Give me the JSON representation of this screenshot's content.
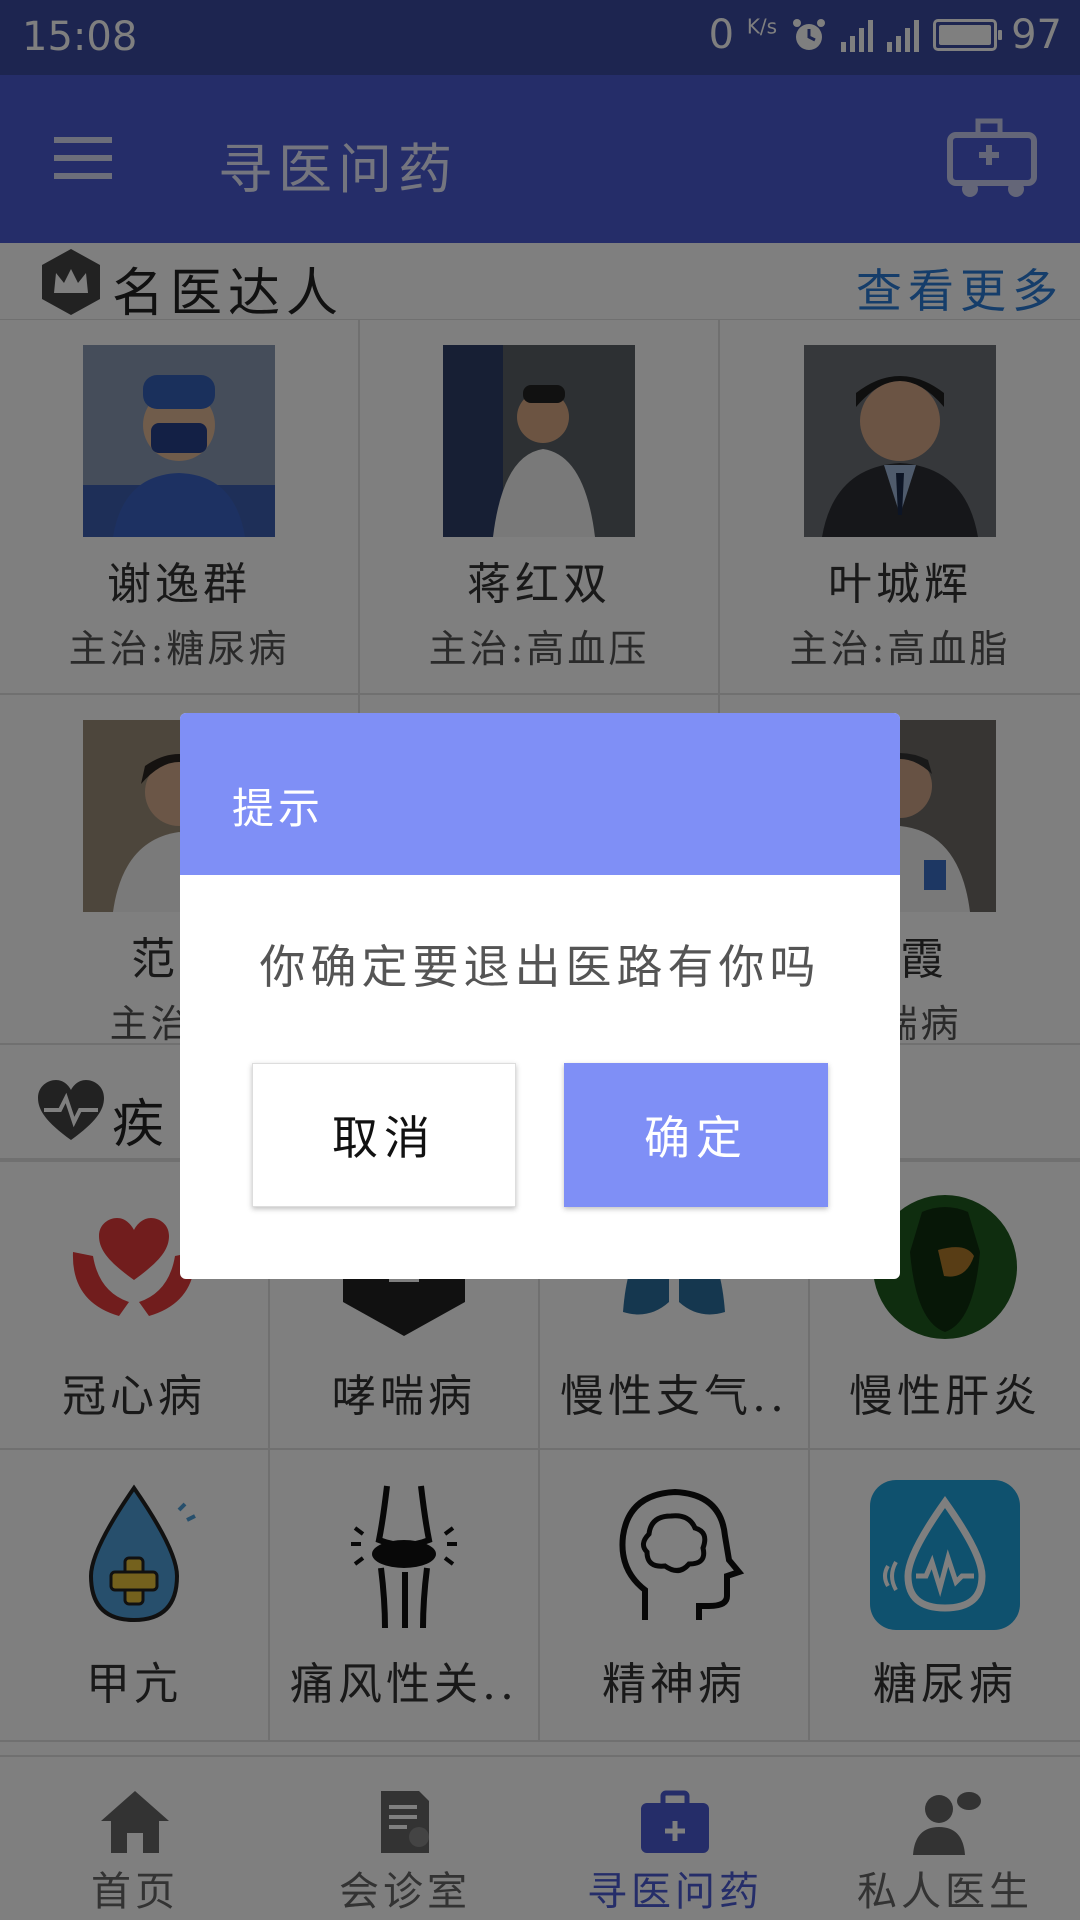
{
  "status_bar": {
    "time": "15:08",
    "net_speed": "0",
    "net_unit": "K/s",
    "network": "4G",
    "battery": "97"
  },
  "app_bar": {
    "title": "寻医问药",
    "menu_icon": "hamburger-menu-icon",
    "action_icon": "ambulance-icon"
  },
  "famous_doctors": {
    "title": "名医达人",
    "more_label": "查看更多",
    "doctors": [
      {
        "name": "谢逸群",
        "specialty": "主治:糖尿病"
      },
      {
        "name": "蒋红双",
        "specialty": "主治:高血压"
      },
      {
        "name": "叶城辉",
        "specialty": "主治:高血脂"
      },
      {
        "name": "范宇",
        "specialty": "主治:宪"
      },
      {
        "name": "",
        "specialty": ""
      },
      {
        "name": "建霞",
        "specialty": "孝喘病"
      }
    ]
  },
  "diseases": {
    "title": "疾",
    "items": [
      {
        "label": "冠心病",
        "icon": "heart-hands-icon"
      },
      {
        "label": "哮喘病",
        "icon": "asthma-icon"
      },
      {
        "label": "慢性支气..",
        "icon": "lungs-icon"
      },
      {
        "label": "慢性肝炎",
        "icon": "liver-icon"
      },
      {
        "label": "甲亢",
        "icon": "water-drop-plus-icon"
      },
      {
        "label": "痛风性关..",
        "icon": "knee-joint-icon"
      },
      {
        "label": "精神病",
        "icon": "brain-head-icon"
      },
      {
        "label": "糖尿病",
        "icon": "diabetes-drop-icon"
      }
    ]
  },
  "bottom_nav": {
    "items": [
      {
        "label": "首页",
        "icon": "home-icon"
      },
      {
        "label": "会诊室",
        "icon": "consultation-icon"
      },
      {
        "label": "寻医问药",
        "icon": "medical-kit-icon"
      },
      {
        "label": "私人医生",
        "icon": "doctor-icon"
      }
    ],
    "active_index": 2
  },
  "dialog": {
    "title": "提示",
    "message": "你确定要退出医路有你吗",
    "cancel_label": "取消",
    "confirm_label": "确定"
  },
  "colors": {
    "primary": "#4a5bd3",
    "dialog_accent": "#7f8ff6",
    "link": "#2b7bd4"
  }
}
